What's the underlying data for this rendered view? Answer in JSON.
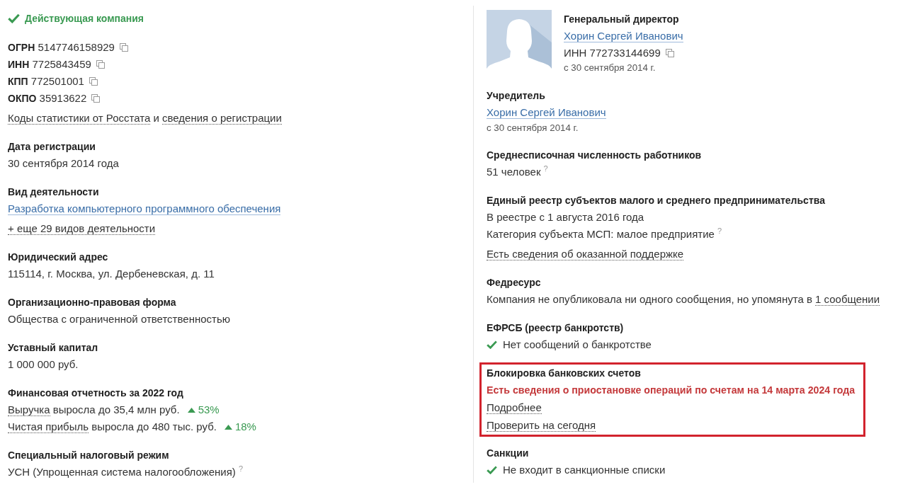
{
  "company_status": {
    "kind": "active",
    "text": "Действующая компания"
  },
  "identifiers": [
    {
      "label": "ОГРН",
      "value": "5147746158929"
    },
    {
      "label": "ИНН",
      "value": "7725843459"
    },
    {
      "label": "КПП",
      "value": "772501001"
    },
    {
      "label": "ОКПО",
      "value": "35913622"
    }
  ],
  "registry_links": {
    "parts": [
      {
        "kind": "dotted",
        "text": "Коды статистики от Росстата"
      },
      {
        "kind": "plain",
        "text": "и"
      },
      {
        "kind": "dotted",
        "text": "сведения о регистрации"
      }
    ]
  },
  "left_sections": [
    {
      "heading": "Дата регистрации",
      "highlighted": false,
      "lines": [
        {
          "kind": "text",
          "text": "30 сентября 2014 года"
        }
      ]
    },
    {
      "heading": "Вид деятельности",
      "highlighted": false,
      "lines": [
        {
          "kind": "link",
          "text": "Разработка компьютерного программного обеспечения"
        },
        {
          "kind": "dotted",
          "text": "+ еще 29 видов деятельности"
        }
      ]
    },
    {
      "heading": "Юридический адрес",
      "highlighted": false,
      "lines": [
        {
          "kind": "text",
          "text": "115114, г. Москва, ул. Дербеневская, д. 11"
        }
      ]
    },
    {
      "heading": "Организационно-правовая форма",
      "highlighted": false,
      "lines": [
        {
          "kind": "text",
          "text": "Общества с ограниченной ответственностью"
        }
      ]
    },
    {
      "heading": "Уставный капитал",
      "highlighted": false,
      "lines": [
        {
          "kind": "text",
          "text": "1 000 000 руб."
        }
      ]
    },
    {
      "heading": "Финансовая отчетность за 2022 год",
      "highlighted": false,
      "lines": [
        {
          "kind": "metric",
          "parts": [
            {
              "kind": "dotted",
              "text": "Выручка"
            },
            {
              "kind": "plain",
              "text": "выросла до 35,4 млн руб."
            }
          ],
          "increase": true,
          "change": "53%"
        },
        {
          "kind": "metric",
          "parts": [
            {
              "kind": "dotted",
              "text": "Чистая прибыль"
            },
            {
              "kind": "plain",
              "text": "выросла до 480 тыс. руб."
            }
          ],
          "increase": true,
          "change": "18%"
        }
      ]
    },
    {
      "heading": "Специальный налоговый режим",
      "highlighted": false,
      "lines": [
        {
          "kind": "text",
          "text": "УСН (Упрощенная система налогообложения)",
          "hint": "?"
        }
      ]
    }
  ],
  "director": {
    "role": "Генеральный директор",
    "name": "Хорин Сергей Иванович",
    "inn": "ИНН 772733144699",
    "since": "с 30 сентября 2014 г."
  },
  "right_sections": [
    {
      "heading": "Учредитель",
      "highlighted": false,
      "lines": [
        {
          "kind": "link",
          "text": "Хорин Сергей Иванович"
        },
        {
          "kind": "small",
          "text": "с 30 сентября 2014 г."
        }
      ]
    },
    {
      "heading": "Среднесписочная численность работников",
      "highlighted": false,
      "lines": [
        {
          "kind": "text",
          "text": "51 человек",
          "hint": "?"
        }
      ]
    },
    {
      "heading": "Единый реестр субъектов малого и среднего предпринимательства",
      "highlighted": false,
      "lines": [
        {
          "kind": "text",
          "text": "В реестре с 1 августа 2016 года"
        },
        {
          "kind": "text",
          "text": "Категория субъекта МСП: малое предприятие",
          "hint": "?"
        },
        {
          "kind": "dotted",
          "text": "Есть сведения об оказанной поддержке"
        }
      ]
    },
    {
      "heading": "Федресурс",
      "highlighted": false,
      "lines": [
        {
          "kind": "sentence",
          "parts": [
            {
              "kind": "plain",
              "text": "Компания не опубликовала ни одного сообщения, но упомянута в"
            },
            {
              "kind": "dotted",
              "text": "1 сообщении"
            }
          ]
        }
      ]
    },
    {
      "heading": "ЕФРСБ (реестр банкротств)",
      "highlighted": false,
      "lines": [
        {
          "kind": "check",
          "text": "Нет сообщений о банкротстве"
        }
      ]
    },
    {
      "heading": "Блокировка банковских счетов",
      "highlighted": true,
      "lines": [
        {
          "kind": "alert",
          "text": "Есть сведения о приостановке операций по счетам на 14 марта 2024 года"
        },
        {
          "kind": "dotted",
          "text": "Подробнее"
        },
        {
          "kind": "dotted",
          "text": "Проверить на сегодня"
        }
      ]
    },
    {
      "heading": "Санкции",
      "highlighted": false,
      "lines": [
        {
          "kind": "check",
          "text": "Не входит в санкционные списки"
        }
      ]
    }
  ]
}
